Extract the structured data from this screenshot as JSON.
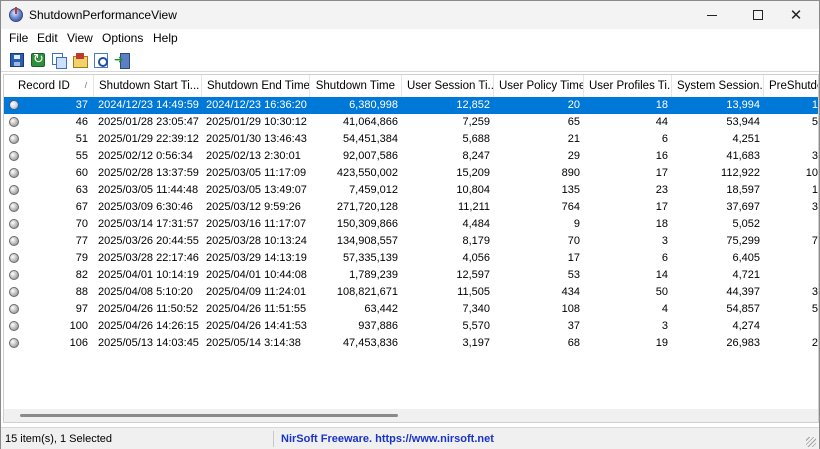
{
  "window": {
    "title": "ShutdownPerformanceView"
  },
  "menu": [
    "File",
    "Edit",
    "View",
    "Options",
    "Help"
  ],
  "toolbar": {
    "icons": [
      "save-icon",
      "refresh-icon",
      "copy-icon",
      "properties-icon",
      "find-icon",
      "exit-icon"
    ]
  },
  "table": {
    "columns": [
      "Record ID",
      "Shutdown Start Ti...",
      "Shutdown End Time",
      "Shutdown Time",
      "User Session Ti...",
      "User Policy Time",
      "User Profiles Ti...",
      "System Session...",
      "PreShutdo"
    ],
    "sort_indicator": "/",
    "rows": [
      [
        "37",
        "2024/12/23 14:49:59",
        "2024/12/23 16:36:20",
        "6,380,998",
        "12,852",
        "20",
        "18",
        "13,994",
        "1"
      ],
      [
        "46",
        "2025/01/28 23:05:47",
        "2025/01/29 10:30:12",
        "41,064,866",
        "7,259",
        "65",
        "44",
        "53,944",
        "5"
      ],
      [
        "51",
        "2025/01/29 22:39:12",
        "2025/01/30 13:46:43",
        "54,451,384",
        "5,688",
        "21",
        "6",
        "4,251",
        ""
      ],
      [
        "55",
        "2025/02/12 0:56:34",
        "2025/02/13 2:30:01",
        "92,007,586",
        "8,247",
        "29",
        "16",
        "41,683",
        "3"
      ],
      [
        "60",
        "2025/02/28 13:37:59",
        "2025/03/05 11:17:09",
        "423,550,002",
        "15,209",
        "890",
        "17",
        "112,922",
        "10"
      ],
      [
        "63",
        "2025/03/05 11:44:48",
        "2025/03/05 13:49:07",
        "7,459,012",
        "10,804",
        "135",
        "23",
        "18,597",
        "1"
      ],
      [
        "67",
        "2025/03/09 6:30:46",
        "2025/03/12 9:59:26",
        "271,720,128",
        "11,211",
        "764",
        "17",
        "37,697",
        "3"
      ],
      [
        "70",
        "2025/03/14 17:31:57",
        "2025/03/16 11:17:07",
        "150,309,866",
        "4,484",
        "9",
        "18",
        "5,052",
        ""
      ],
      [
        "77",
        "2025/03/26 20:44:55",
        "2025/03/28 10:13:24",
        "134,908,557",
        "8,179",
        "70",
        "3",
        "75,299",
        "7"
      ],
      [
        "79",
        "2025/03/28 22:17:46",
        "2025/03/29 14:13:19",
        "57,335,139",
        "4,056",
        "17",
        "6",
        "6,405",
        ""
      ],
      [
        "82",
        "2025/04/01 10:14:19",
        "2025/04/01 10:44:08",
        "1,789,239",
        "12,597",
        "53",
        "14",
        "4,721",
        ""
      ],
      [
        "88",
        "2025/04/08 5:10:20",
        "2025/04/09 11:24:01",
        "108,821,671",
        "11,505",
        "434",
        "50",
        "44,397",
        "3"
      ],
      [
        "97",
        "2025/04/26 11:50:52",
        "2025/04/26 11:51:55",
        "63,442",
        "7,340",
        "108",
        "4",
        "54,857",
        "5"
      ],
      [
        "100",
        "2025/04/26 14:26:15",
        "2025/04/26 14:41:53",
        "937,886",
        "5,570",
        "37",
        "3",
        "4,274",
        ""
      ],
      [
        "106",
        "2025/05/13 14:03:45",
        "2025/05/14 3:14:38",
        "47,453,836",
        "3,197",
        "68",
        "19",
        "26,983",
        "2"
      ]
    ],
    "selected_index": 0
  },
  "status": {
    "count": "15 item(s), 1 Selected",
    "link": "NirSoft Freeware. https://www.nirsoft.net"
  }
}
